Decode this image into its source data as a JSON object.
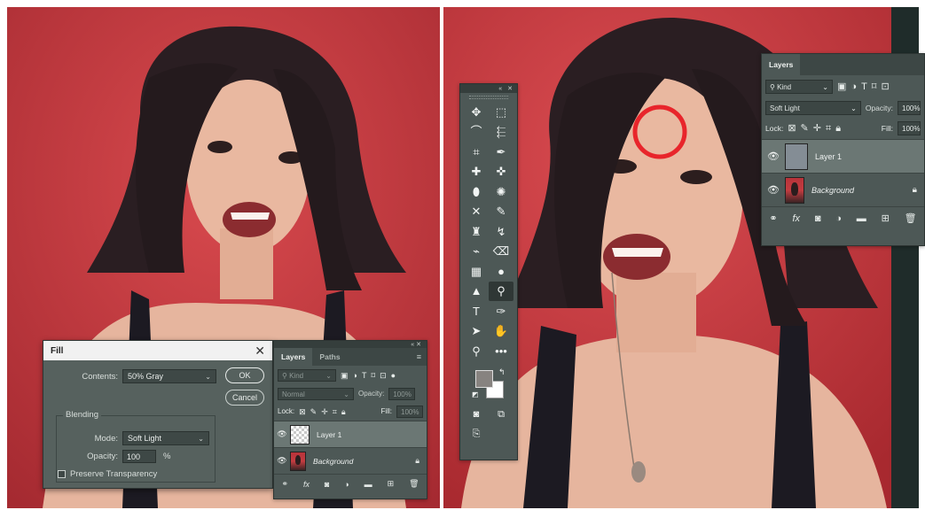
{
  "fill_dialog": {
    "title": "Fill",
    "contents_label": "Contents:",
    "contents_value": "50% Gray",
    "ok_label": "OK",
    "cancel_label": "Cancel",
    "blending_label": "Blending",
    "mode_label": "Mode:",
    "mode_value": "Soft Light",
    "opacity_label": "Opacity:",
    "opacity_value": "100",
    "opacity_unit": "%",
    "preserve_transparency_label": "Preserve Transparency",
    "preserve_transparency_checked": false
  },
  "layers_panel_small": {
    "tabs": [
      "Layers",
      "Paths"
    ],
    "kind_label": "Kind",
    "blend_mode": "Normal",
    "opacity_label": "Opacity:",
    "opacity_value": "100%",
    "lock_label": "Lock:",
    "fill_label": "Fill:",
    "fill_value": "100%",
    "layers": [
      {
        "name": "Layer 1",
        "selected": true,
        "thumb": "transparent"
      },
      {
        "name": "Background",
        "selected": false,
        "thumb": "photo",
        "locked": true
      }
    ]
  },
  "layers_panel_large": {
    "tabs": [
      "Layers"
    ],
    "kind_label": "Kind",
    "blend_mode": "Soft Light",
    "opacity_label": "Opacity:",
    "opacity_value": "100%",
    "lock_label": "Lock:",
    "fill_label": "Fill:",
    "fill_value": "100%",
    "layers": [
      {
        "name": "Layer 1",
        "selected": true,
        "thumb": "gray"
      },
      {
        "name": "Background",
        "selected": false,
        "thumb": "photo",
        "locked": true
      }
    ]
  },
  "toolbar": {
    "tools": [
      "move-tool",
      "marquee-tool",
      "lasso-tool",
      "object-select-tool",
      "crop-tool",
      "eyedropper-tool",
      "healing-brush-tool",
      "patch-tool",
      "bandaid-tool",
      "stamp-pattern-tool",
      "content-aware-move-tool",
      "brush-tool",
      "clone-stamp-tool",
      "history-brush-tool",
      "mixer-brush-tool",
      "eraser-tool",
      "gradient-tool",
      "blur-tool",
      "sharpen-tool",
      "dodge-tool",
      "type-tool",
      "pen-tool",
      "path-select-tool",
      "hand-tool",
      "zoom-tool",
      "more-tools"
    ],
    "active_tool": "dodge-tool",
    "foreground_color": "#878380",
    "background_color": "#ffffff"
  },
  "colors": {
    "panel_bg": "#4d5856",
    "backdrop_red": "#c8393f",
    "highlight_circle": "#e8252b"
  }
}
